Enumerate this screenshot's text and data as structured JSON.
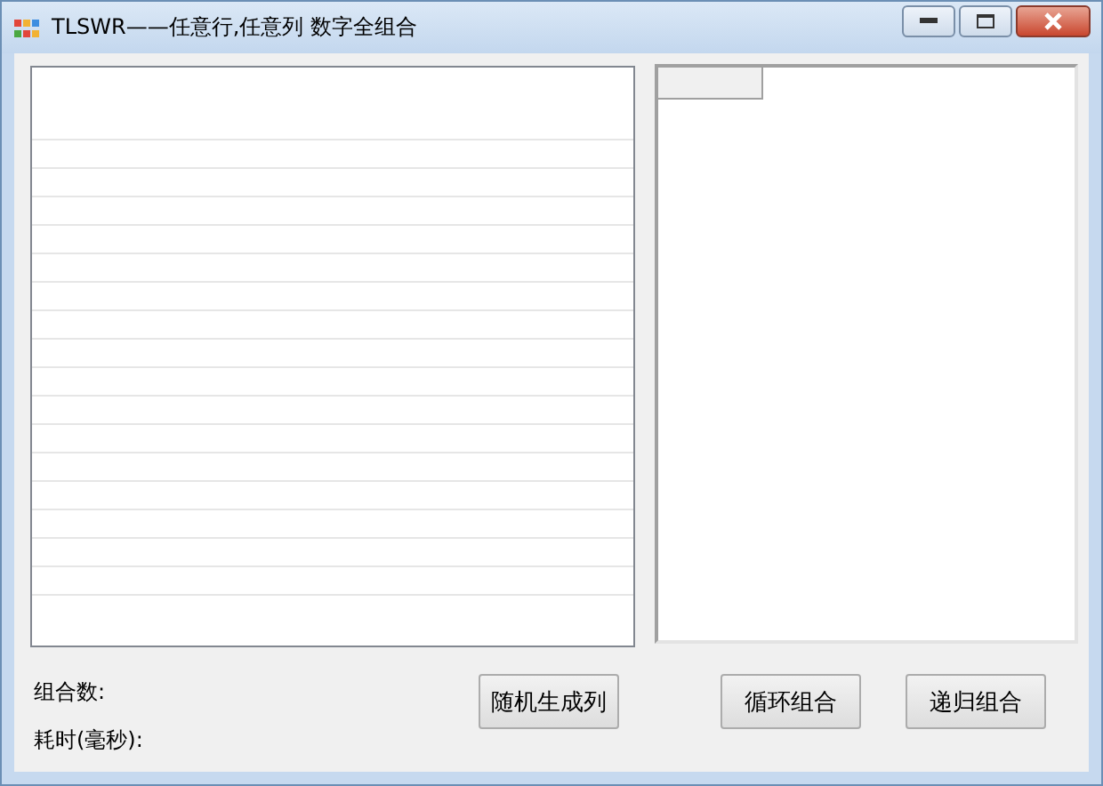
{
  "window": {
    "title": "TLSWR——任意行,任意列 数字全组合"
  },
  "labels": [
    "组合数:",
    "耗时(毫秒):"
  ],
  "buttons": [
    "随机生成列",
    "循环组合",
    "递归组合"
  ]
}
